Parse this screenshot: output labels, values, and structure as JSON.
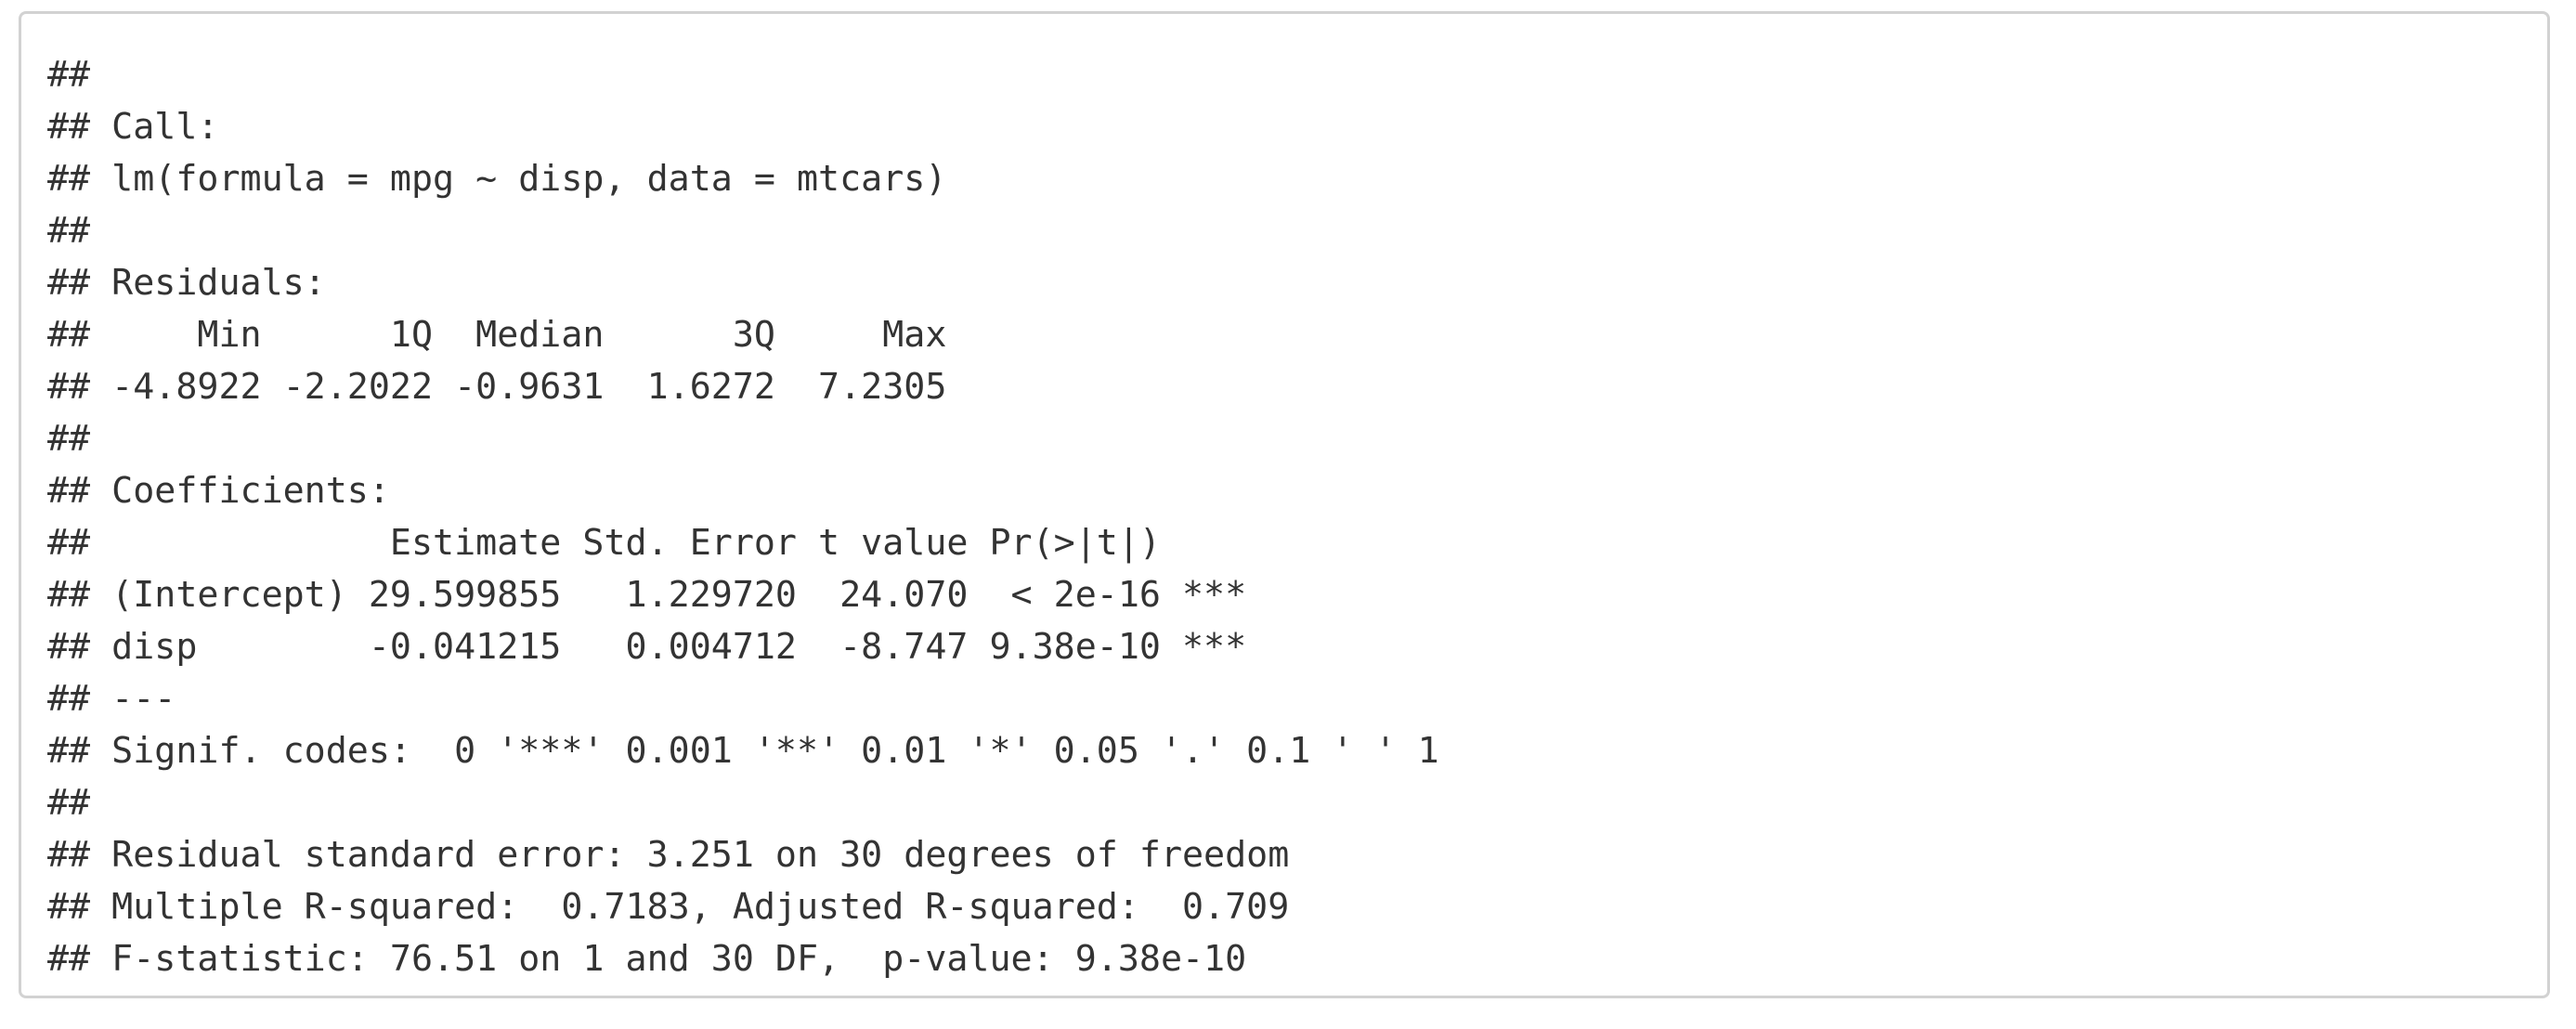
{
  "console_output": {
    "lines": [
      "##",
      "## Call:",
      "## lm(formula = mpg ~ disp, data = mtcars)",
      "##",
      "## Residuals:",
      "##     Min      1Q  Median      3Q     Max",
      "## -4.8922 -2.2022 -0.9631  1.6272  7.2305",
      "##",
      "## Coefficients:",
      "##              Estimate Std. Error t value Pr(>|t|)",
      "## (Intercept) 29.599855   1.229720  24.070  < 2e-16 ***",
      "## disp        -0.041215   0.004712  -8.747 9.38e-10 ***",
      "## ---",
      "## Signif. codes:  0 '***' 0.001 '**' 0.01 '*' 0.05 '.' 0.1 ' ' 1",
      "##",
      "## Residual standard error: 3.251 on 30 degrees of freedom",
      "## Multiple R-squared:  0.7183, Adjusted R-squared:  0.709",
      "## F-statistic: 76.51 on 1 and 30 DF,  p-value: 9.38e-10"
    ]
  }
}
